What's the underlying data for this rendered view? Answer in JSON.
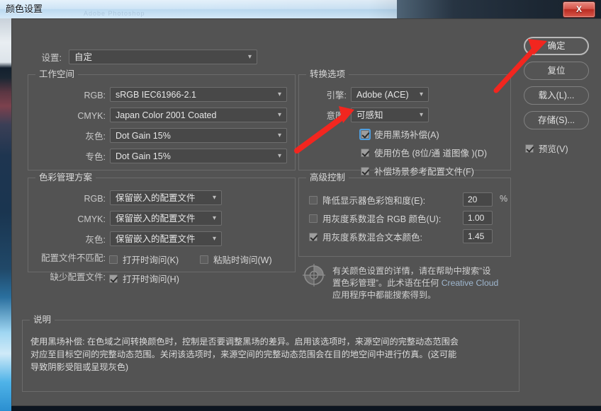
{
  "window": {
    "title": "颜色设置",
    "ghost_text": "Adobe Photoshop",
    "close_label": "X"
  },
  "settings_row": {
    "label": "设置:",
    "value": "自定",
    "caret": "chevron-down-icon"
  },
  "working_spaces": {
    "title": "工作空间",
    "rows": [
      {
        "label": "RGB:",
        "value": "sRGB IEC61966-2.1"
      },
      {
        "label": "CMYK:",
        "value": "Japan Color 2001 Coated"
      },
      {
        "label": "灰色:",
        "value": "Dot Gain 15%"
      },
      {
        "label": "专色:",
        "value": "Dot Gain 15%"
      }
    ]
  },
  "color_management_policies": {
    "title": "色彩管理方案",
    "rows": [
      {
        "label": "RGB:",
        "value": "保留嵌入的配置文件"
      },
      {
        "label": "CMYK:",
        "value": "保留嵌入的配置文件"
      },
      {
        "label": "灰色:",
        "value": "保留嵌入的配置文件"
      }
    ],
    "mismatch_label": "配置文件不匹配:",
    "mismatch_open": {
      "text": "打开时询问(K)",
      "checked": false
    },
    "mismatch_paste": {
      "text": "粘贴时询问(W)",
      "checked": false
    },
    "missing_label": "缺少配置文件:",
    "missing_open": {
      "text": "打开时询问(H)",
      "checked": true
    }
  },
  "conversion_options": {
    "title": "转换选项",
    "engine_label": "引擎:",
    "engine_value": "Adobe (ACE)",
    "intent_label": "意图:",
    "intent_value": "可感知",
    "black_point": {
      "text": "使用黑场补偿(A)",
      "checked": true,
      "focused": true
    },
    "dither": {
      "text": "使用仿色 (8位/通 道图像 )(D)",
      "checked": true
    },
    "scene_referred": {
      "text": "补偿场景参考配置文件(F)",
      "checked": true
    }
  },
  "advanced_controls": {
    "title": "高级控制",
    "desaturate": {
      "text": "降低显示器色彩饱和度(E):",
      "checked": false,
      "value": "20",
      "unit": "%"
    },
    "blend_rgb": {
      "text": "用灰度系数混合 RGB 颜色(U):",
      "checked": false,
      "value": "1.00"
    },
    "blend_text": {
      "text": "用灰度系数混合文本颜色:",
      "checked": true,
      "value": "1.45"
    }
  },
  "info_note": {
    "icon": "color-settings-gear-icon",
    "line1": "有关颜色设置的详情，请在帮助中搜索”设",
    "line2_a": "置色彩管理”。此术语在任何 ",
    "line2_cc": "Creative Cloud",
    "line3": "应用程序中都能搜索得到。"
  },
  "description": {
    "title": "说明",
    "line1": "使用黑场补偿: 在色域之间转换颜色时，控制是否要调整黑场的差异。启用该选项时，来源空间的完整动态范围会",
    "line2": "对应至目标空间的完整动态范围。关闭该选项时，来源空间的完整动态范围会在目的地空间中进行仿真。(这可能",
    "line3": "导致阴影受阻或呈现灰色)"
  },
  "buttons": {
    "ok": "确定",
    "reset": "复位",
    "load": "载入(L)...",
    "save": "存储(S)...",
    "preview": {
      "text": "预览(V)",
      "checked": true
    }
  },
  "colors": {
    "dialog_bg": "#535353",
    "field_bg": "#484848",
    "accent_focus": "#4f9fe0",
    "arrow_red": "#f2261f",
    "mnemonic": "#b4c7dd"
  }
}
